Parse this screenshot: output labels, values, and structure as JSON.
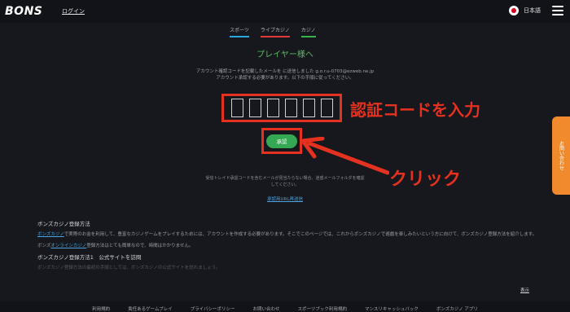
{
  "header": {
    "logo": "BONS",
    "login_label": "ログイン",
    "language_label": "日本語",
    "flag_icon": "japan-flag-icon",
    "menu_icon": "hamburger-menu-icon"
  },
  "tabs": [
    {
      "label": "スポーツ",
      "color": "#2aa8e0"
    },
    {
      "label": "ライブカジノ",
      "color": "#e03a3a"
    },
    {
      "label": "カジノ",
      "color": "#38b24a"
    }
  ],
  "verification": {
    "heading": "プレイヤー様へ",
    "instruction_line1": "アカウント確認コードを記載したメールを に送信しました g.o.r.u-0703@ezweb.ne.jp",
    "instruction_line2": "アカウント承認する必要があります。以下の手順に従ってください。",
    "digit_count": 6,
    "submit_label": "承認",
    "note": "受信トレイド承認コードを含むメールが見当たらない場合、迷惑メールフォルダを確認してください。",
    "resend_label": "承認用URL再送信"
  },
  "annotations": {
    "code_hint": "認証コードを入力",
    "click_hint": "クリック",
    "highlight_color": "#e5311f"
  },
  "contact_tab_label": "お問い合わせ",
  "seo": {
    "heading1": "ボンズカジノ登録方法",
    "para1_link": "ボンズカジノ",
    "para1_text": "で実際のお金を利用して、豊富なカジノゲームをプレイするためには、アカウントを作成する必要があります。そこでこのページでは、これからボンズカジノで遊戯を楽しみたいという方に向けて、ボンズカジノ登録方法を紹介します。",
    "para2_prefix": "ボンズ",
    "para2_link": "オンラインカジノ",
    "para2_text": "登録方法はとても簡単なので、時間はかかりません。",
    "heading2": "ボンズカジノ登録方法1　公式サイトを訪問",
    "para3": "ボンズカジノ登録方法の最初の手順としては、ボンズカジノの公式サイトを訪れましょう。",
    "more_label": "表示"
  },
  "footer": {
    "links": [
      "利用規約",
      "責任あるゲームプレイ",
      "プライバシーポリシー",
      "お問い合わせ",
      "スポーツブック利用規約",
      "マンスリキャッシュバック",
      "ボンズカジノ アプリ"
    ]
  }
}
